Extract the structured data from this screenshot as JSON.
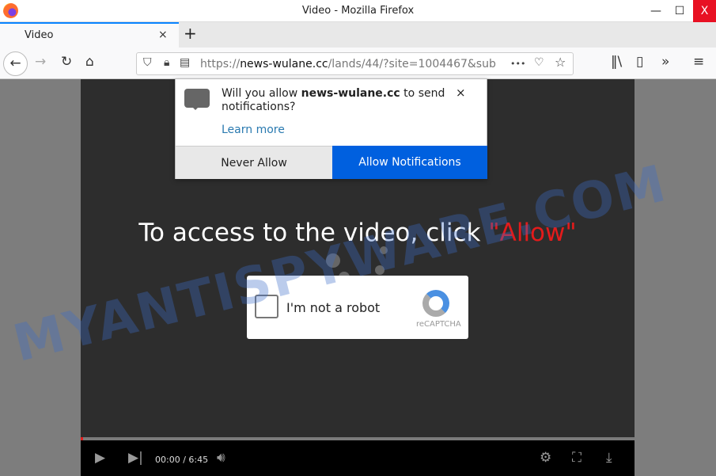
{
  "window": {
    "title": "Video - Mozilla Firefox",
    "minimize": "—",
    "maximize": "☐",
    "close": "X"
  },
  "tab": {
    "label": "Video",
    "close": "×",
    "new_tab": "+"
  },
  "nav": {
    "url_prefix": "https://",
    "url_domain": "news-wulane.cc",
    "url_rest": "/lands/44/?site=1004467&sub",
    "more": "•••"
  },
  "popup": {
    "text_before": "Will you allow ",
    "domain": "news-wulane.cc",
    "text_after": " to send notifications?",
    "learn_more": "Learn more",
    "never_allow": "Never Allow",
    "allow_notifications": "Allow Notifications",
    "close": "×"
  },
  "page": {
    "headline": "To access to the video, click ",
    "headline_allow": "\"Allow\""
  },
  "captcha": {
    "label": "I'm not a robot",
    "brand": "reCAPTCHA"
  },
  "player": {
    "time": "00:00 / 6:45",
    "progress_percent": 0.4
  },
  "watermark": "MYANTISPYWARE.COM",
  "colors": {
    "accent": "#0060df",
    "allow_red": "#e31b1b",
    "close_red": "#e81123"
  }
}
